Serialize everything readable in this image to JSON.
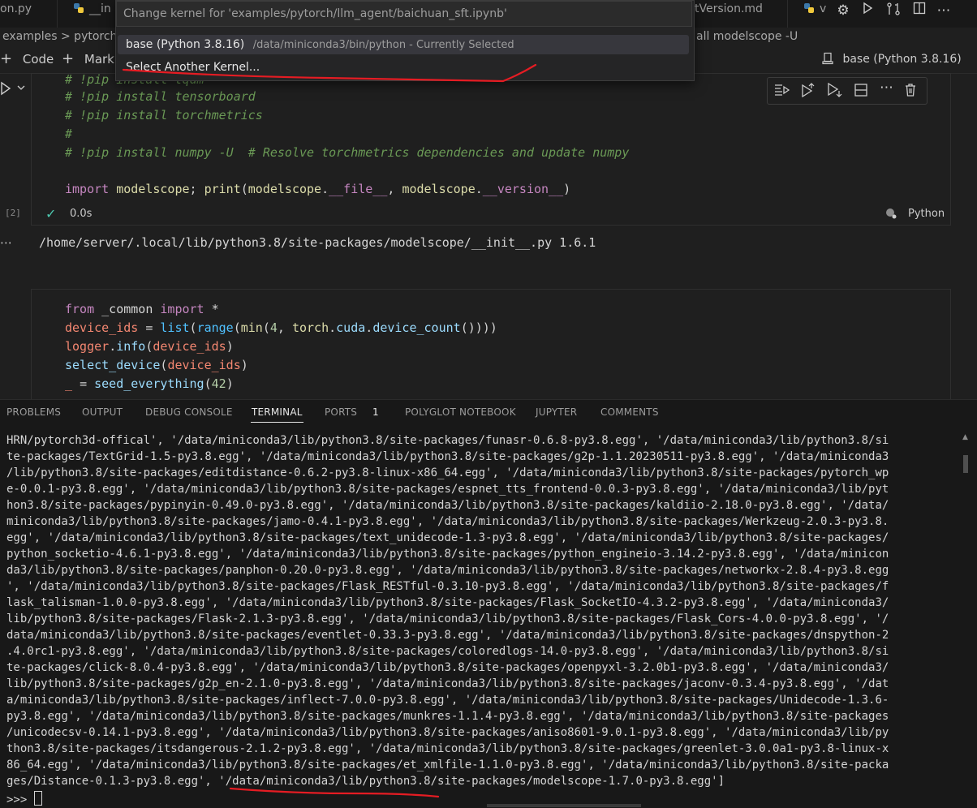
{
  "tabs": [
    {
      "label": "on.py"
    },
    {
      "label": "__in"
    },
    {
      "label": "tVersion.md"
    },
    {
      "label": "v"
    }
  ],
  "quickpick": {
    "placeholder": "Change kernel for 'examples/pytorch/llm_agent/baichuan_sft.ipynb'",
    "item1_name": "base (Python 3.8.16)",
    "item1_path": "/data/miniconda3/bin/python - Currently Selected",
    "item2": "Select Another Kernel..."
  },
  "breadcrumb": {
    "left": "examples > pytorch",
    "right": "all modelscope -U"
  },
  "toolbar": {
    "code": "Code",
    "markdown": "Mark",
    "kernel": "base (Python 3.8.16)"
  },
  "cell1": {
    "lines": [
      "# !pip install tqdm",
      "# !pip install tensorboard",
      "# !pip install torchmetrics",
      "#",
      "# !pip install numpy -U  # Resolve torchmetrics dependencies and update numpy"
    ],
    "exec_count": "[2]",
    "time": "0.0s",
    "lang": "Python",
    "output": "/home/server/.local/lib/python3.8/site-packages/modelscope/__init__.py 1.6.1"
  },
  "panel_tabs": [
    "PROBLEMS",
    "OUTPUT",
    "DEBUG CONSOLE",
    "TERMINAL",
    "PORTS",
    "POLYGLOT NOTEBOOK",
    "JUPYTER",
    "COMMENTS"
  ],
  "ports_badge": "1",
  "terminal_text": "HRN/pytorch3d-offical', '/data/miniconda3/lib/python3.8/site-packages/funasr-0.6.8-py3.8.egg', '/data/miniconda3/lib/python3.8/si\nte-packages/TextGrid-1.5-py3.8.egg', '/data/miniconda3/lib/python3.8/site-packages/g2p-1.1.20230511-py3.8.egg', '/data/miniconda3\n/lib/python3.8/site-packages/editdistance-0.6.2-py3.8-linux-x86_64.egg', '/data/miniconda3/lib/python3.8/site-packages/pytorch_wp\ne-0.0.1-py3.8.egg', '/data/miniconda3/lib/python3.8/site-packages/espnet_tts_frontend-0.0.3-py3.8.egg', '/data/miniconda3/lib/pyt\nhon3.8/site-packages/pypinyin-0.49.0-py3.8.egg', '/data/miniconda3/lib/python3.8/site-packages/kaldiio-2.18.0-py3.8.egg', '/data/\nminiconda3/lib/python3.8/site-packages/jamo-0.4.1-py3.8.egg', '/data/miniconda3/lib/python3.8/site-packages/Werkzeug-2.0.3-py3.8.\negg', '/data/miniconda3/lib/python3.8/site-packages/text_unidecode-1.3-py3.8.egg', '/data/miniconda3/lib/python3.8/site-packages/\npython_socketio-4.6.1-py3.8.egg', '/data/miniconda3/lib/python3.8/site-packages/python_engineio-3.14.2-py3.8.egg', '/data/minicon\nda3/lib/python3.8/site-packages/panphon-0.20.0-py3.8.egg', '/data/miniconda3/lib/python3.8/site-packages/networkx-2.8.4-py3.8.egg\n', '/data/miniconda3/lib/python3.8/site-packages/Flask_RESTful-0.3.10-py3.8.egg', '/data/miniconda3/lib/python3.8/site-packages/f\nlask_talisman-1.0.0-py3.8.egg', '/data/miniconda3/lib/python3.8/site-packages/Flask_SocketIO-4.3.2-py3.8.egg', '/data/miniconda3/\nlib/python3.8/site-packages/Flask-2.1.3-py3.8.egg', '/data/miniconda3/lib/python3.8/site-packages/Flask_Cors-4.0.0-py3.8.egg', '/\ndata/miniconda3/lib/python3.8/site-packages/eventlet-0.33.3-py3.8.egg', '/data/miniconda3/lib/python3.8/site-packages/dnspython-2\n.4.0rc1-py3.8.egg', '/data/miniconda3/lib/python3.8/site-packages/coloredlogs-14.0-py3.8.egg', '/data/miniconda3/lib/python3.8/si\nte-packages/click-8.0.4-py3.8.egg', '/data/miniconda3/lib/python3.8/site-packages/openpyxl-3.2.0b1-py3.8.egg', '/data/miniconda3/\nlib/python3.8/site-packages/g2p_en-2.1.0-py3.8.egg', '/data/miniconda3/lib/python3.8/site-packages/jaconv-0.3.4-py3.8.egg', '/dat\na/miniconda3/lib/python3.8/site-packages/inflect-7.0.0-py3.8.egg', '/data/miniconda3/lib/python3.8/site-packages/Unidecode-1.3.6-\npy3.8.egg', '/data/miniconda3/lib/python3.8/site-packages/munkres-1.1.4-py3.8.egg', '/data/miniconda3/lib/python3.8/site-packages\n/unicodecsv-0.14.1-py3.8.egg', '/data/miniconda3/lib/python3.8/site-packages/aniso8601-9.0.1-py3.8.egg', '/data/miniconda3/lib/py\nthon3.8/site-packages/itsdangerous-2.1.2-py3.8.egg', '/data/miniconda3/lib/python3.8/site-packages/greenlet-3.0.0a1-py3.8-linux-x\n86_64.egg', '/data/miniconda3/lib/python3.8/site-packages/et_xmlfile-1.1.0-py3.8.egg', '/data/miniconda3/lib/python3.8/site-packa\nges/Distance-0.1.3-py3.8.egg', '/data/miniconda3/lib/python3.8/site-packages/modelscope-1.7.0-py3.8.egg']",
  "prompt": ">>> ",
  "colors": {
    "accent": "#0078d4",
    "annotation": "#e51c23",
    "check": "#4ec9b0"
  }
}
